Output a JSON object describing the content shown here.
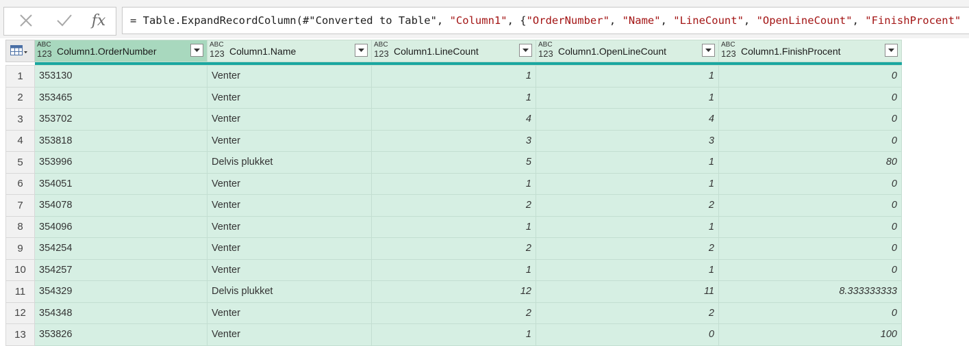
{
  "formula": {
    "prefix": "= Table.ExpandRecordColumn(#\"Converted to Table\", ",
    "arg1": "\"Column1\"",
    "sep1": ", {",
    "f1": "\"OrderNumber\"",
    "sep2": ", ",
    "f2": "\"Name\"",
    "sep3": ", ",
    "f3": "\"LineCount\"",
    "sep4": ", ",
    "f4": "\"OpenLineCount\"",
    "sep5": ", ",
    "f5": "\"FinishProcent\"",
    "cancel_icon": "close-icon",
    "confirm_icon": "check-icon",
    "fx_label": "fx"
  },
  "type_icon": {
    "top": "ABC",
    "bottom": "123"
  },
  "columns": [
    "Column1.OrderNumber",
    "Column1.Name",
    "Column1.LineCount",
    "Column1.OpenLineCount",
    "Column1.FinishProcent"
  ],
  "rows": [
    [
      "1",
      "353130",
      "Venter",
      "1",
      "1",
      "0"
    ],
    [
      "2",
      "353465",
      "Venter",
      "1",
      "1",
      "0"
    ],
    [
      "3",
      "353702",
      "Venter",
      "4",
      "4",
      "0"
    ],
    [
      "4",
      "353818",
      "Venter",
      "3",
      "3",
      "0"
    ],
    [
      "5",
      "353996",
      "Delvis plukket",
      "5",
      "1",
      "80"
    ],
    [
      "6",
      "354051",
      "Venter",
      "1",
      "1",
      "0"
    ],
    [
      "7",
      "354078",
      "Venter",
      "2",
      "2",
      "0"
    ],
    [
      "8",
      "354096",
      "Venter",
      "1",
      "1",
      "0"
    ],
    [
      "9",
      "354254",
      "Venter",
      "2",
      "2",
      "0"
    ],
    [
      "10",
      "354257",
      "Venter",
      "1",
      "1",
      "0"
    ],
    [
      "11",
      "354329",
      "Delvis plukket",
      "12",
      "11",
      "8.333333333"
    ],
    [
      "12",
      "354348",
      "Venter",
      "2",
      "2",
      "0"
    ],
    [
      "13",
      "353826",
      "Venter",
      "1",
      "0",
      "100"
    ]
  ],
  "colors": {
    "header_bg": "#d9efe2",
    "selected_header_bg": "#a8d8be",
    "quality_bar": "#1aa7a0",
    "cell_bg": "#d6efe3"
  }
}
